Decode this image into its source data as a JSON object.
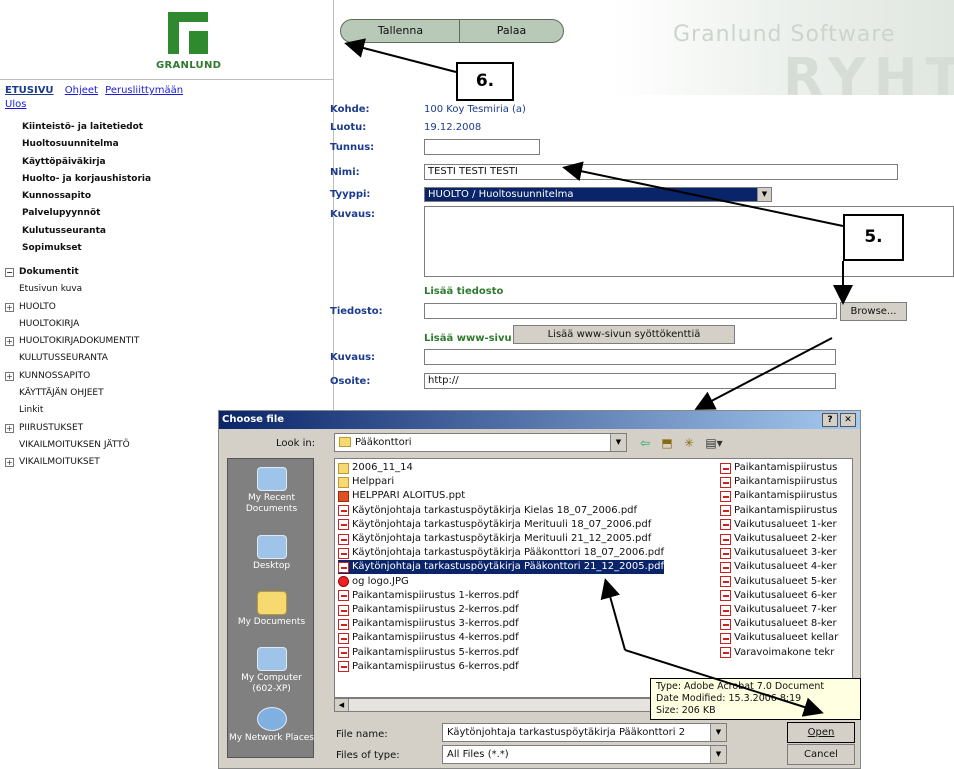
{
  "sidebar": {
    "logo_text": "GRANLUND",
    "etusivu": "ETUSIVU",
    "top_links": [
      "Ohjeet",
      "Perusliittymään"
    ],
    "ulos": "Ulos",
    "nav_items": [
      "Kiinteistö- ja laitetiedot",
      "Huoltosuunnitelma",
      "Käyttöpäiväkirja",
      "Huolto- ja korjaushistoria",
      "Kunnossapito",
      "Palvelupyynnöt",
      "Kulutusseuranta",
      "Sopimukset"
    ],
    "docs_title": "Dokumentit",
    "doc_items": [
      "Etusivun kuva",
      "HUOLTO",
      "HUOLTOKIRJA",
      "HUOLTOKIRJADOKUMENTIT",
      "KULUTUSSEURANTA",
      "KUNNOSSAPITO",
      "KÄYTTÄJÄN OHJEET",
      "Linkit",
      "PIIRUSTUKSET",
      "VIKAILMOITUKSEN JÄTTÖ",
      "VIKAILMOITUKSET"
    ]
  },
  "header": {
    "save_label": "Tallenna",
    "back_label": "Palaa",
    "brand": "Granlund Software",
    "brand_large": "RYHT"
  },
  "form": {
    "kohde_label": "Kohde:",
    "kohde_value": "100 Koy Tesmiria (a)",
    "luotu_label": "Luotu:",
    "luotu_value": "19.12.2008",
    "tunnus_label": "Tunnus:",
    "tunnus_value": "",
    "nimi_label": "Nimi:",
    "nimi_value": "TESTI TESTI TESTI",
    "tyyppi_label": "Tyyppi:",
    "tyyppi_value": "HUOLTO / Huoltosuunnitelma",
    "kuvaus_label": "Kuvaus:",
    "kuvaus_value": "",
    "add_file_label": "Lisää tiedosto",
    "tiedosto_label": "Tiedosto:",
    "tiedosto_value": "",
    "browse_label": "Browse...",
    "add_www_label": "Lisää www-sivu",
    "add_www_fields_button": "Lisää www-sivun syöttökenttiä",
    "kuvaus2_label": "Kuvaus:",
    "kuvaus2_value": "",
    "osoite_label": "Osoite:",
    "osoite_value": "http://"
  },
  "callouts": {
    "c6": "6.",
    "c5": "5."
  },
  "dialog": {
    "title": "Choose file",
    "help_btn": "?",
    "close_btn": "✕",
    "look_in_label": "Look in:",
    "look_in_value": "Pääkonttori",
    "places": [
      "My Recent Documents",
      "Desktop",
      "My Documents",
      "My Computer (602-XP)",
      "My Network Places"
    ],
    "files_col1": [
      {
        "name": "2006_11_14",
        "type": "folder"
      },
      {
        "name": "Helppari",
        "type": "folder"
      },
      {
        "name": "HELPPARI ALOITUS.ppt",
        "type": "ppt"
      },
      {
        "name": "Käytönjohtaja tarkastuspöytäkirja Kielas 18_07_2006.pdf",
        "type": "pdf"
      },
      {
        "name": "Käytönjohtaja tarkastuspöytäkirja Merituuli 18_07_2006.pdf",
        "type": "pdf"
      },
      {
        "name": "Käytönjohtaja tarkastuspöytäkirja Merituuli 21_12_2005.pdf",
        "type": "pdf"
      },
      {
        "name": "Käytönjohtaja tarkastuspöytäkirja Pääkonttori 18_07_2006.pdf",
        "type": "pdf"
      },
      {
        "name": "Käytönjohtaja tarkastuspöytäkirja Pääkonttori 21_12_2005.pdf",
        "type": "pdf",
        "selected": true
      },
      {
        "name": "og logo.JPG",
        "type": "jpg"
      },
      {
        "name": "Paikantamispiirustus 1-kerros.pdf",
        "type": "pdf"
      },
      {
        "name": "Paikantamispiirustus 2-kerros.pdf",
        "type": "pdf"
      },
      {
        "name": "Paikantamispiirustus 3-kerros.pdf",
        "type": "pdf"
      },
      {
        "name": "Paikantamispiirustus 4-kerros.pdf",
        "type": "pdf"
      },
      {
        "name": "Paikantamispiirustus 5-kerros.pdf",
        "type": "pdf"
      },
      {
        "name": "Paikantamispiirustus 6-kerros.pdf",
        "type": "pdf"
      }
    ],
    "files_col2": [
      {
        "name": "Paikantamispiirustus",
        "type": "pdf"
      },
      {
        "name": "Paikantamispiirustus",
        "type": "pdf"
      },
      {
        "name": "Paikantamispiirustus",
        "type": "pdf"
      },
      {
        "name": "Paikantamispiirustus",
        "type": "pdf"
      },
      {
        "name": "Vaikutusalueet 1-ker",
        "type": "pdf"
      },
      {
        "name": "Vaikutusalueet 2-ker",
        "type": "pdf"
      },
      {
        "name": "Vaikutusalueet 3-ker",
        "type": "pdf"
      },
      {
        "name": "Vaikutusalueet 4-ker",
        "type": "pdf"
      },
      {
        "name": "Vaikutusalueet 5-ker",
        "type": "pdf"
      },
      {
        "name": "Vaikutusalueet 6-ker",
        "type": "pdf"
      },
      {
        "name": "Vaikutusalueet 7-ker",
        "type": "pdf"
      },
      {
        "name": "Vaikutusalueet 8-ker",
        "type": "pdf"
      },
      {
        "name": "Vaikutusalueet kellar",
        "type": "pdf"
      },
      {
        "name": "Varavoimakone tekr",
        "type": "pdf"
      }
    ],
    "file_name_label": "File name:",
    "file_name_value": "Käytönjohtaja tarkastuspöytäkirja Pääkonttori 2",
    "file_type_label": "Files of type:",
    "file_type_value": "All Files (*.*)",
    "open_label": "Open",
    "cancel_label": "Cancel",
    "tooltip": [
      "Type: Adobe Acrobat 7.0 Document",
      "Date Modified: 15.3.2006 8:19",
      "Size: 206 KB"
    ]
  },
  "colors": {
    "accent": "#1c3b8e",
    "brand_green": "#2f8a2f",
    "selection": "#0a246a",
    "dialog_bg": "#d4d0c8"
  }
}
